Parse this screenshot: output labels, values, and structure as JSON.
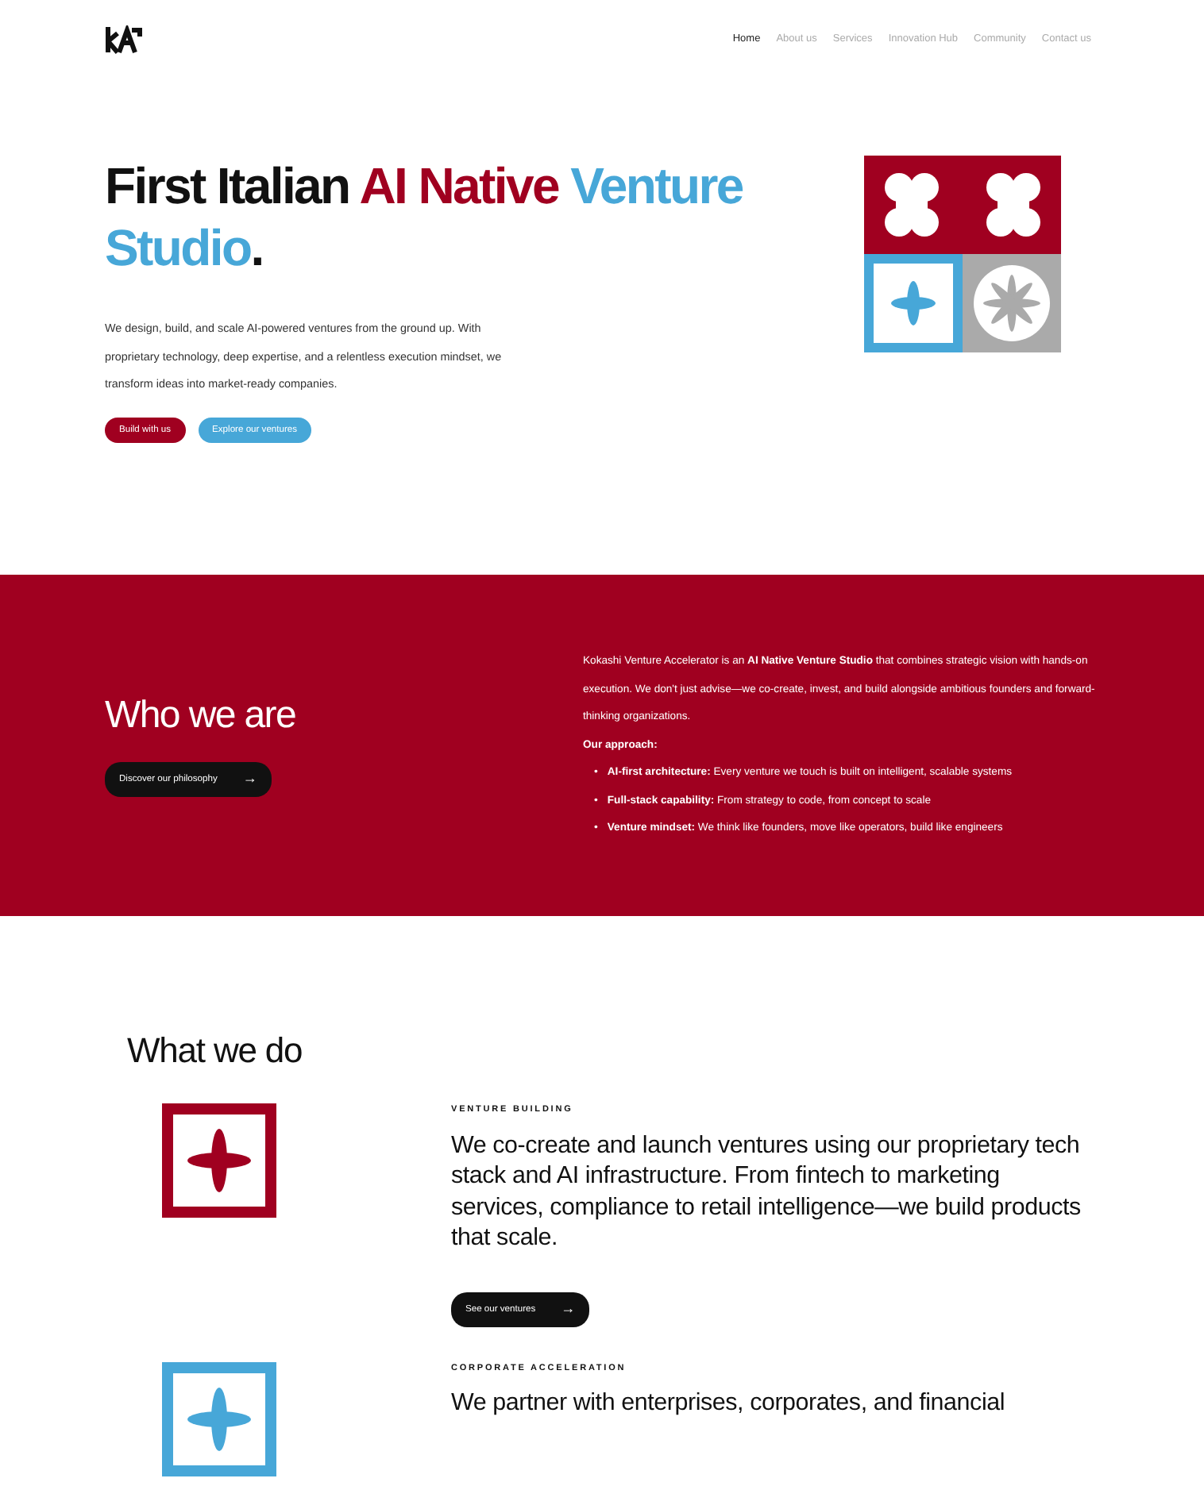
{
  "nav": {
    "links": [
      {
        "label": "Home",
        "selected": true
      },
      {
        "label": "About us",
        "selected": false
      },
      {
        "label": "Services",
        "selected": false
      },
      {
        "label": "Innovation Hub",
        "selected": false
      },
      {
        "label": "Community",
        "selected": false
      },
      {
        "label": "Contact us",
        "selected": false
      }
    ]
  },
  "hero": {
    "title_parts": [
      {
        "text": "First Italian ",
        "kind": "dark"
      },
      {
        "text": "AI Native ",
        "kind": "red"
      },
      {
        "text": "Venture Studio",
        "kind": "blue"
      },
      {
        "text": ".",
        "kind": "dark"
      }
    ],
    "paragraph": "We design, build, and scale AI-powered ventures from the ground up. With proprietary technology, deep expertise, and a relentless execution mindset, we transform ideas into market-ready companies.",
    "buttons": [
      {
        "label": "Build with us",
        "kind": "red"
      },
      {
        "label": "Explore our ventures",
        "kind": "blue"
      }
    ]
  },
  "who": {
    "heading": "Who we are",
    "button": "Discover our philosophy",
    "arrow": "→",
    "intro": "Kokashi Venture Accelerator is an **AI Native Venture Studio** that combines strategic vision with hands-on execution. We don't just advise—we co-create, invest, and build alongside ambitious founders and forward-thinking organizations.",
    "approach_label": "Our approach:",
    "bullet": "•",
    "points": [
      {
        "title": "AI-first architecture:",
        "text": " Every venture we touch is built on intelligent, scalable systems"
      },
      {
        "title": "Full-stack capability:",
        "text": " From strategy to code, from concept to scale"
      },
      {
        "title": "Venture mindset:",
        "text": " We think like founders, move like operators, build like engineers"
      }
    ]
  },
  "what": {
    "heading": "What we do",
    "services": [
      {
        "kind": "red",
        "eyebrow": "VENTURE BUILDING",
        "text": "We co-create and launch ventures using our proprietary tech stack and AI infrastructure. From fintech to marketing services, compliance to retail intelligence—we build products that scale.",
        "button": "See our ventures",
        "arrow": "→"
      },
      {
        "kind": "blue",
        "eyebrow": "CORPORATE ACCELERATION",
        "text": "We partner with enterprises, corporates, and financial"
      }
    ]
  }
}
